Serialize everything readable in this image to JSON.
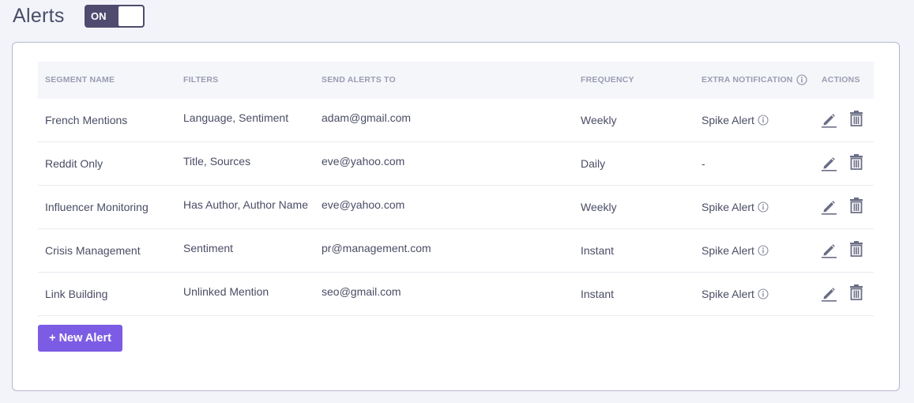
{
  "header": {
    "title": "Alerts",
    "toggle_label": "ON",
    "toggle_state": "on"
  },
  "table": {
    "columns": [
      "SEGMENT NAME",
      "FILTERS",
      "SEND ALERTS TO",
      "FREQUENCY",
      "EXTRA NOTIFICATION",
      "ACTIONS"
    ],
    "rows": [
      {
        "segment": "French Mentions",
        "filters": "Language, Sentiment",
        "send_to": "adam@gmail.com",
        "frequency": "Weekly",
        "extra": "Spike Alert",
        "has_info": true
      },
      {
        "segment": "Reddit Only",
        "filters": "Title, Sources",
        "send_to": "eve@yahoo.com",
        "frequency": "Daily",
        "extra": "-",
        "has_info": false
      },
      {
        "segment": "Influencer Monitoring",
        "filters": "Has Author, Author Name",
        "send_to": "eve@yahoo.com",
        "frequency": "Weekly",
        "extra": "Spike Alert",
        "has_info": true
      },
      {
        "segment": "Crisis Management",
        "filters": "Sentiment",
        "send_to": "pr@management.com",
        "frequency": "Instant",
        "extra": "Spike Alert",
        "has_info": true
      },
      {
        "segment": "Link Building",
        "filters": "Unlinked Mention",
        "send_to": "seo@gmail.com",
        "frequency": "Instant",
        "extra": "Spike Alert",
        "has_info": true
      }
    ],
    "action_icons": [
      "edit-icon",
      "trash-icon"
    ]
  },
  "new_alert_button": "+ New Alert",
  "colors": {
    "accent": "#7c5ce4",
    "toggle": "#4f4b6f",
    "header_bg": "#f4f6fa",
    "page_bg": "#f3f4fa"
  }
}
